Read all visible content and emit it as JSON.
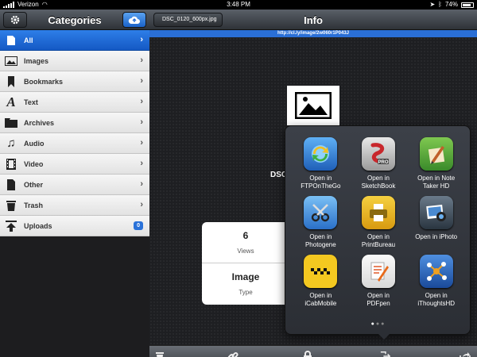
{
  "status": {
    "carrier": "Verizon",
    "time": "3:48 PM",
    "battery": "74%"
  },
  "sidebar": {
    "title": "Categories",
    "items": [
      {
        "label": "All",
        "icon": "file-icon",
        "active": true
      },
      {
        "label": "Images",
        "icon": "image-icon"
      },
      {
        "label": "Bookmarks",
        "icon": "bookmark-icon"
      },
      {
        "label": "Text",
        "icon": "text-icon"
      },
      {
        "label": "Archives",
        "icon": "archive-icon"
      },
      {
        "label": "Audio",
        "icon": "music-icon"
      },
      {
        "label": "Video",
        "icon": "film-icon"
      },
      {
        "label": "Other",
        "icon": "document-icon"
      },
      {
        "label": "Trash",
        "icon": "trash-icon"
      },
      {
        "label": "Uploads",
        "icon": "upload-icon",
        "badge": "0"
      }
    ]
  },
  "info": {
    "back_label": "DSC_0120_600px.jpg",
    "title": "Info",
    "url": "http://cl.ly/image/2w060r1P043J",
    "filename_visible": "DSC",
    "views_value": "6",
    "views_label": "Views",
    "type_value": "Image",
    "type_label": "Type"
  },
  "open_in": {
    "apps": [
      {
        "line1": "Open in",
        "line2": "FTPOnTheGo",
        "color": "#2a7fd4"
      },
      {
        "line1": "Open in",
        "line2": "SketchBook",
        "color": "#c8272c"
      },
      {
        "line1": "Open in Note",
        "line2": "Taker HD",
        "color": "#5aa83a"
      },
      {
        "line1": "Open in",
        "line2": "Photogene",
        "color": "#3a8ad6"
      },
      {
        "line1": "Open in",
        "line2": "PrintBureau",
        "color": "#e8b21a"
      },
      {
        "line1": "Open in iPhoto",
        "line2": "",
        "color": "#4a5a6a"
      },
      {
        "line1": "Open in",
        "line2": "iCabMobile",
        "color": "#f0c020"
      },
      {
        "line1": "Open in",
        "line2": "PDFpen",
        "color": "#f2f2f2"
      },
      {
        "line1": "Open in",
        "line2": "iThoughtsHD",
        "color": "#2f6fc8"
      }
    ],
    "page_count": 3,
    "current_page": 1
  }
}
